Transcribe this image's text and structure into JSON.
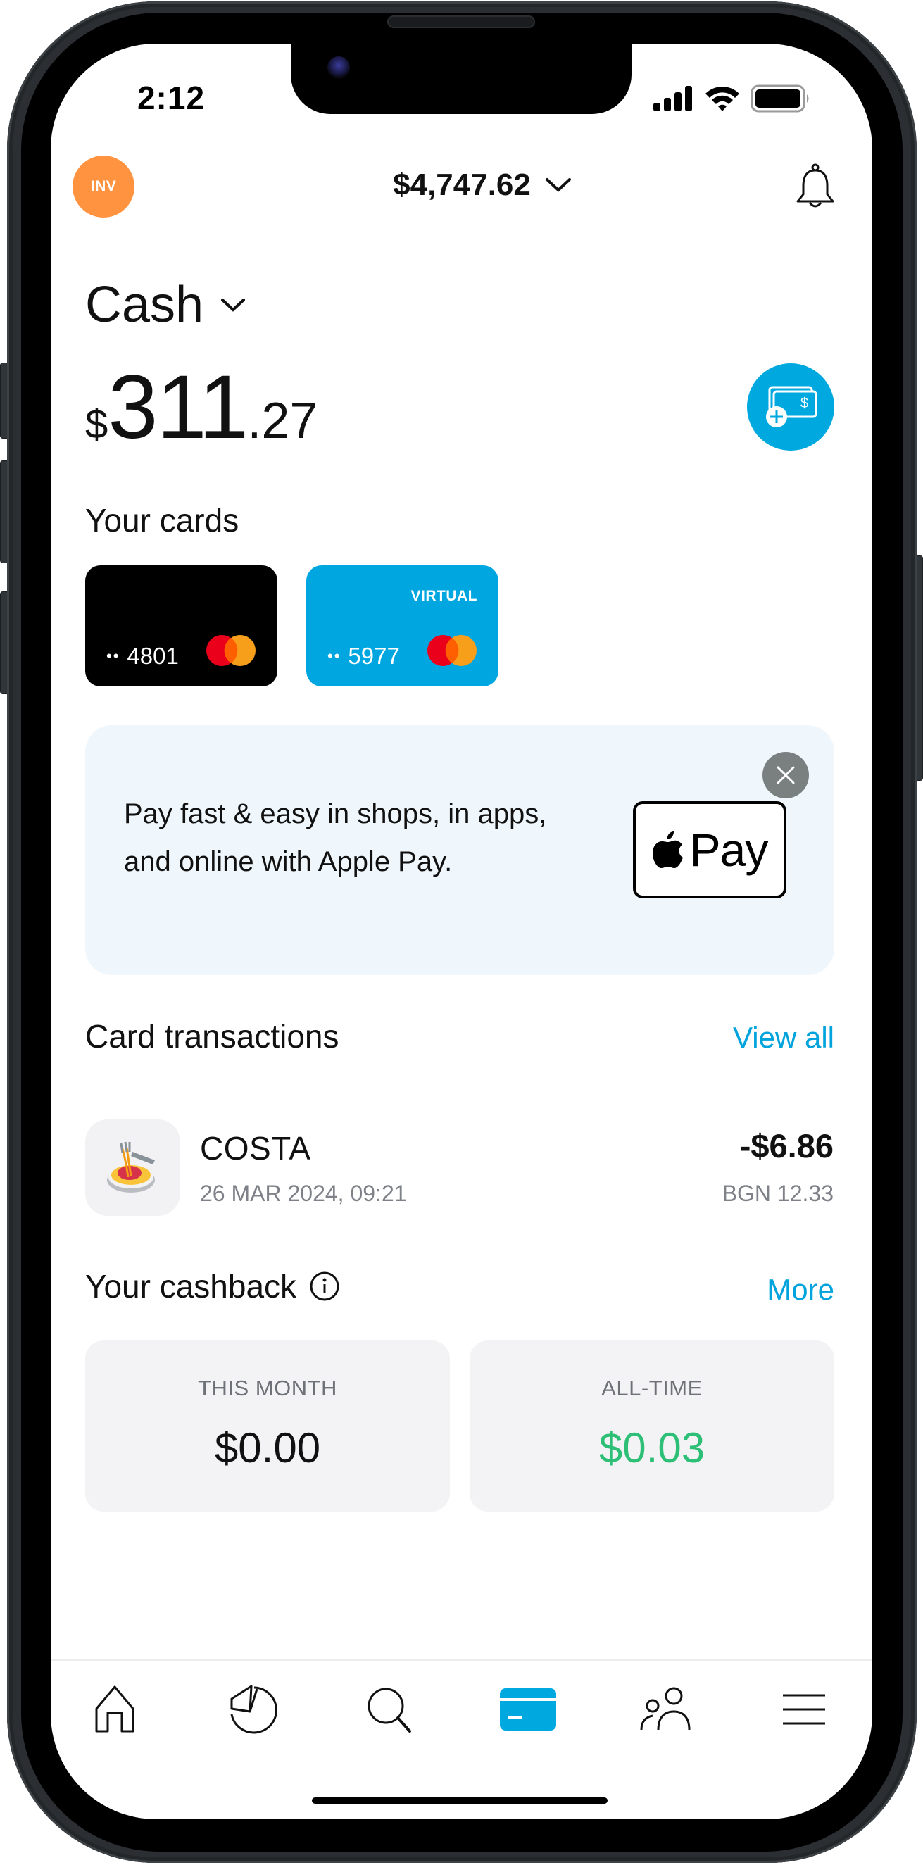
{
  "status_bar": {
    "time": "2:12",
    "icons": [
      "cellular-signal-icon",
      "wifi-icon",
      "battery-icon"
    ]
  },
  "header": {
    "avatar_initials": "INV",
    "avatar_color": "#ff9340",
    "total_balance": "$4,747.62",
    "total_balance_icon": "chevron-down-icon",
    "notifications_icon": "bell-icon"
  },
  "account": {
    "name": "Cash",
    "name_icon": "chevron-down-icon",
    "balance_currency": "$",
    "balance_integer": "311",
    "balance_decimal": ".27",
    "add_money_icon": "add-money-icon",
    "accent_color": "#00a8e0"
  },
  "cards": {
    "title": "Your cards",
    "items": [
      {
        "type": "physical",
        "masked_dots": "••",
        "last4": "4801",
        "tag": "",
        "network": "mastercard",
        "color": "#000000"
      },
      {
        "type": "virtual",
        "masked_dots": "••",
        "last4": "5977",
        "tag": "VIRTUAL",
        "network": "mastercard",
        "color": "#00a6e0"
      }
    ]
  },
  "promo_banner": {
    "text": "Pay fast & easy in shops, in apps, and online with Apple Pay.",
    "badge_label": "Pay",
    "badge_icon": "apple-logo-icon",
    "close_icon": "close-icon"
  },
  "transactions": {
    "title": "Card transactions",
    "view_all_label": "View all",
    "items": [
      {
        "icon": "spaghetti-icon",
        "merchant": "COSTA",
        "datetime": "26 MAR 2024, 09:21",
        "amount": "-$6.86",
        "foreign_amount": "BGN 12.33"
      }
    ]
  },
  "cashback": {
    "title": "Your cashback",
    "info_icon": "info-icon",
    "more_label": "More",
    "this_month_label": "THIS MONTH",
    "this_month_value": "$0.00",
    "all_time_label": "ALL-TIME",
    "all_time_value": "$0.03",
    "positive_color": "#2dbf75"
  },
  "tab_bar": {
    "items": [
      {
        "name": "home",
        "icon": "home-icon",
        "active": false
      },
      {
        "name": "analytics",
        "icon": "pie-chart-icon",
        "active": false
      },
      {
        "name": "search",
        "icon": "search-icon",
        "active": false
      },
      {
        "name": "cards",
        "icon": "card-icon",
        "active": true
      },
      {
        "name": "friends",
        "icon": "people-icon",
        "active": false
      },
      {
        "name": "menu",
        "icon": "menu-icon",
        "active": false
      }
    ]
  }
}
